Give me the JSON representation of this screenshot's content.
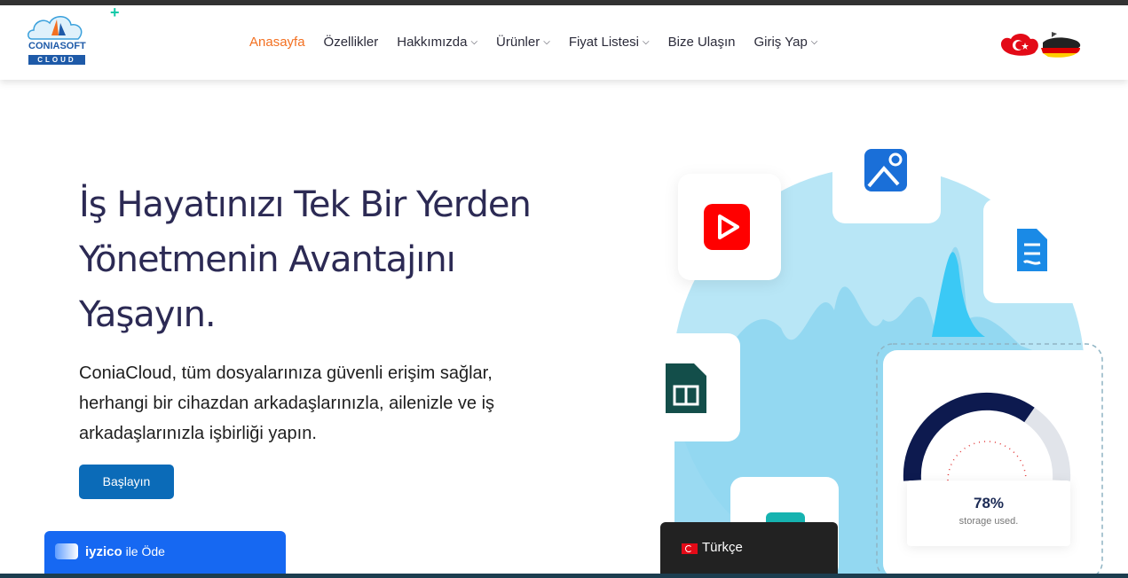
{
  "brand": {
    "logo_text": "CONIASOFT",
    "logo_sub": "CLOUD"
  },
  "nav": {
    "items": [
      {
        "label": "Anasayfa",
        "active": true,
        "has_dropdown": false
      },
      {
        "label": "Özellikler",
        "active": false,
        "has_dropdown": false
      },
      {
        "label": "Hakkımızda",
        "active": false,
        "has_dropdown": true
      },
      {
        "label": "Ürünler",
        "active": false,
        "has_dropdown": true
      },
      {
        "label": "Fiyat Listesi",
        "active": false,
        "has_dropdown": true
      },
      {
        "label": "Bize Ulaşın",
        "active": false,
        "has_dropdown": false
      },
      {
        "label": "Giriş Yap",
        "active": false,
        "has_dropdown": true
      }
    ],
    "chevron": "⌵"
  },
  "hero": {
    "title_line1": "İş Hayatınızı Tek Bir Yerden",
    "title_line2": "Yönetmenin Avantajını",
    "title_line3": "Yaşayın.",
    "description_line1": "ConiaCloud, tüm dosyalarınıza güvenli erişim sağlar,",
    "description_line2": "herhangi bir cihazdan arkadaşlarınızla, ailenizle ve iş",
    "description_line3": "arkadaşlarınızla işbirliği yapın.",
    "cta_label": "Başlayın"
  },
  "storage": {
    "percent_label": "78%",
    "sub_label": "storage used.",
    "used_fraction": 0.78
  },
  "payment_widget": {
    "brand": "iyzico",
    "label": " ile Öde"
  },
  "language_widget": {
    "label": "Türkçe"
  },
  "colors": {
    "accent": "#f37021",
    "primary": "#0b6bb8",
    "title": "#2c2a54",
    "iyzico": "#1668f2"
  },
  "icons": [
    "youtube-play-icon",
    "image-icon",
    "document-icon",
    "spreadsheet-icon",
    "turkey-flag-icon",
    "germany-flag-icon"
  ]
}
